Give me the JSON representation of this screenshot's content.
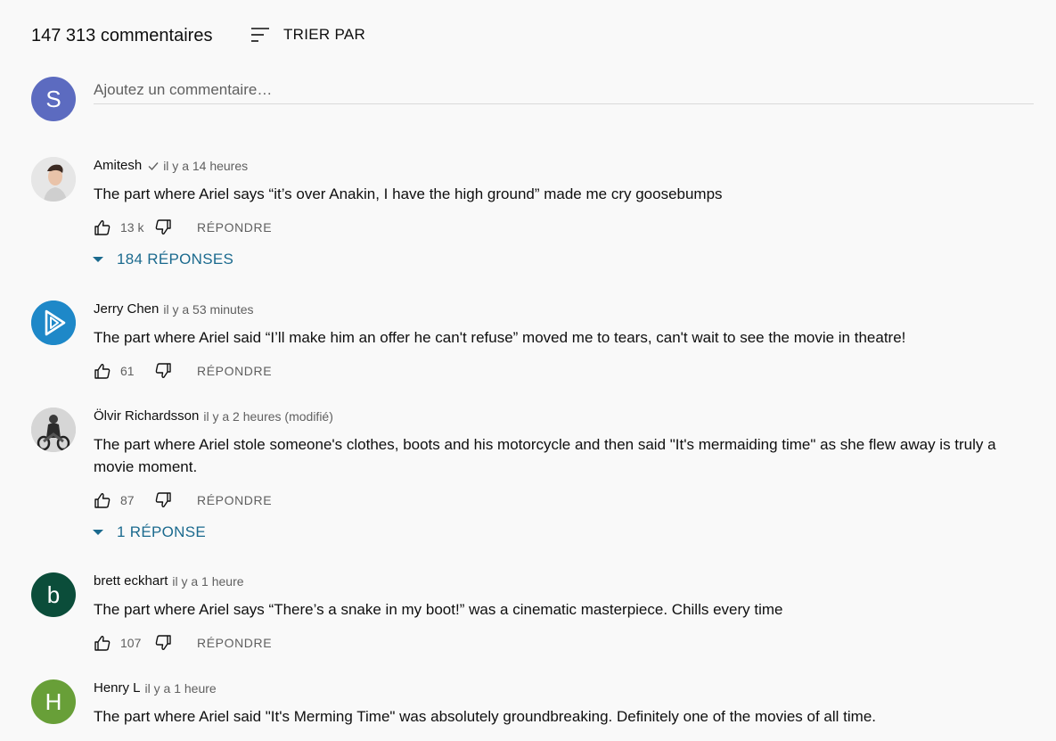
{
  "header": {
    "count_label": "147 313 commentaires",
    "sort_label": "TRIER PAR",
    "sort_icon": "sort-lines-icon"
  },
  "add_comment": {
    "avatar_letter": "S",
    "avatar_color": "#5c6bc0",
    "placeholder": "Ajoutez un commentaire…"
  },
  "comments": [
    {
      "author": "Amitesh",
      "verified": true,
      "time": "il y a 14 heures",
      "text": "The part where Ariel says “it’s over Anakin, I have the high ground” made me cry goosebumps",
      "likes": "13 k",
      "reply_label": "RÉPONDRE",
      "replies_label": "184 RÉPONSES",
      "avatar_type": "photo-portrait"
    },
    {
      "author": "Jerry Chen",
      "time": "il y a 53 minutes",
      "text": "The part where Ariel said “I’ll make him an offer he can't refuse” moved me to tears, can't wait to see the movie in theatre!",
      "likes": "61",
      "reply_label": "RÉPONDRE",
      "avatar_type": "play-logo",
      "avatar_color": "#1e88c8"
    },
    {
      "author": "Ölvir Richardsson",
      "time": "il y a 2 heures (modifié)",
      "text": "The part where Ariel stole someone's clothes, boots and his motorcycle and then said \"It's mermaiding time\" as she flew away is truly a movie moment.",
      "likes": "87",
      "reply_label": "RÉPONDRE",
      "replies_label": "1 RÉPONSE",
      "avatar_type": "photo-motorcycle"
    },
    {
      "author": "brett eckhart",
      "time": "il y a 1 heure",
      "text": "The part where Ariel says “There’s a snake in my boot!” was a cinematic masterpiece. Chills every time",
      "likes": "107",
      "reply_label": "RÉPONDRE",
      "avatar_letter": "b",
      "avatar_color": "#0b4d3a"
    },
    {
      "author": "Henry L",
      "time": "il y a 1 heure",
      "text": "The part where Ariel said \"It's Merming Time\" was absolutely groundbreaking. Definitely one of the movies of all time.",
      "avatar_letter": "H",
      "avatar_color": "#689f38"
    }
  ],
  "colors": {
    "background": "#f9f9f9",
    "replies_link": "#1b6a8e",
    "secondary_text": "#606060"
  }
}
